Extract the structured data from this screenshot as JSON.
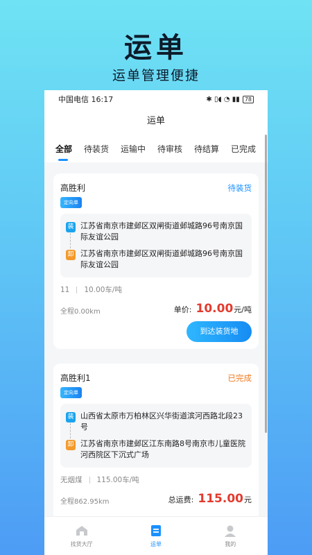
{
  "hero": {
    "title": "运单",
    "subtitle": "运单管理便捷"
  },
  "statusbar": {
    "carrier_time": "中国电信 16:17",
    "icons": "✱ ▯◖ ◔ ▮▮",
    "battery": "78"
  },
  "navbar": {
    "title": "运单"
  },
  "tabs": [
    {
      "label": "全部",
      "active": true
    },
    {
      "label": "待装货"
    },
    {
      "label": "运输中"
    },
    {
      "label": "待审核"
    },
    {
      "label": "待结算"
    },
    {
      "label": "已完成"
    }
  ],
  "orders": [
    {
      "shipper": "高胜利",
      "status": "待装货",
      "tag": "定向单",
      "load_badge": "装",
      "load_address": "江苏省南京市建邺区双闸街道邺城路96号南京国际友谊公园",
      "unload_badge": "卸",
      "unload_address": "江苏省南京市建邺区双闸街道邺城路96号南京国际友谊公园",
      "cargo_name": "11",
      "cargo_qty": "10.00车/吨",
      "distance": "全程0.00km",
      "price_label": "单价:",
      "price_value": "10.00",
      "price_unit": "元/吨",
      "action": "到达装货地"
    },
    {
      "shipper": "高胜利1",
      "status": "已完成",
      "tag": "定向单",
      "load_badge": "装",
      "load_address": "山西省太原市万柏林区兴华街道滨河西路北段23号",
      "unload_badge": "卸",
      "unload_address": "江苏省南京市建邺区江东南路8号南京市儿童医院河西院区下沉式广场",
      "cargo_name": "无烟煤",
      "cargo_qty": "115.00车/吨",
      "distance": "全程862.95km",
      "price_label": "总运费:",
      "price_value": "115.00",
      "price_unit": "元"
    }
  ],
  "bottom_nav": [
    {
      "label": "找货大厅",
      "icon": "home-icon"
    },
    {
      "label": "运单",
      "icon": "waybill-icon",
      "active": true
    },
    {
      "label": "我的",
      "icon": "user-icon"
    }
  ],
  "colors": {
    "accent": "#1a90ff",
    "price": "#e23b2e",
    "done": "#f07a1f",
    "load": "#1aa3ee",
    "unload": "#f39a2b"
  }
}
